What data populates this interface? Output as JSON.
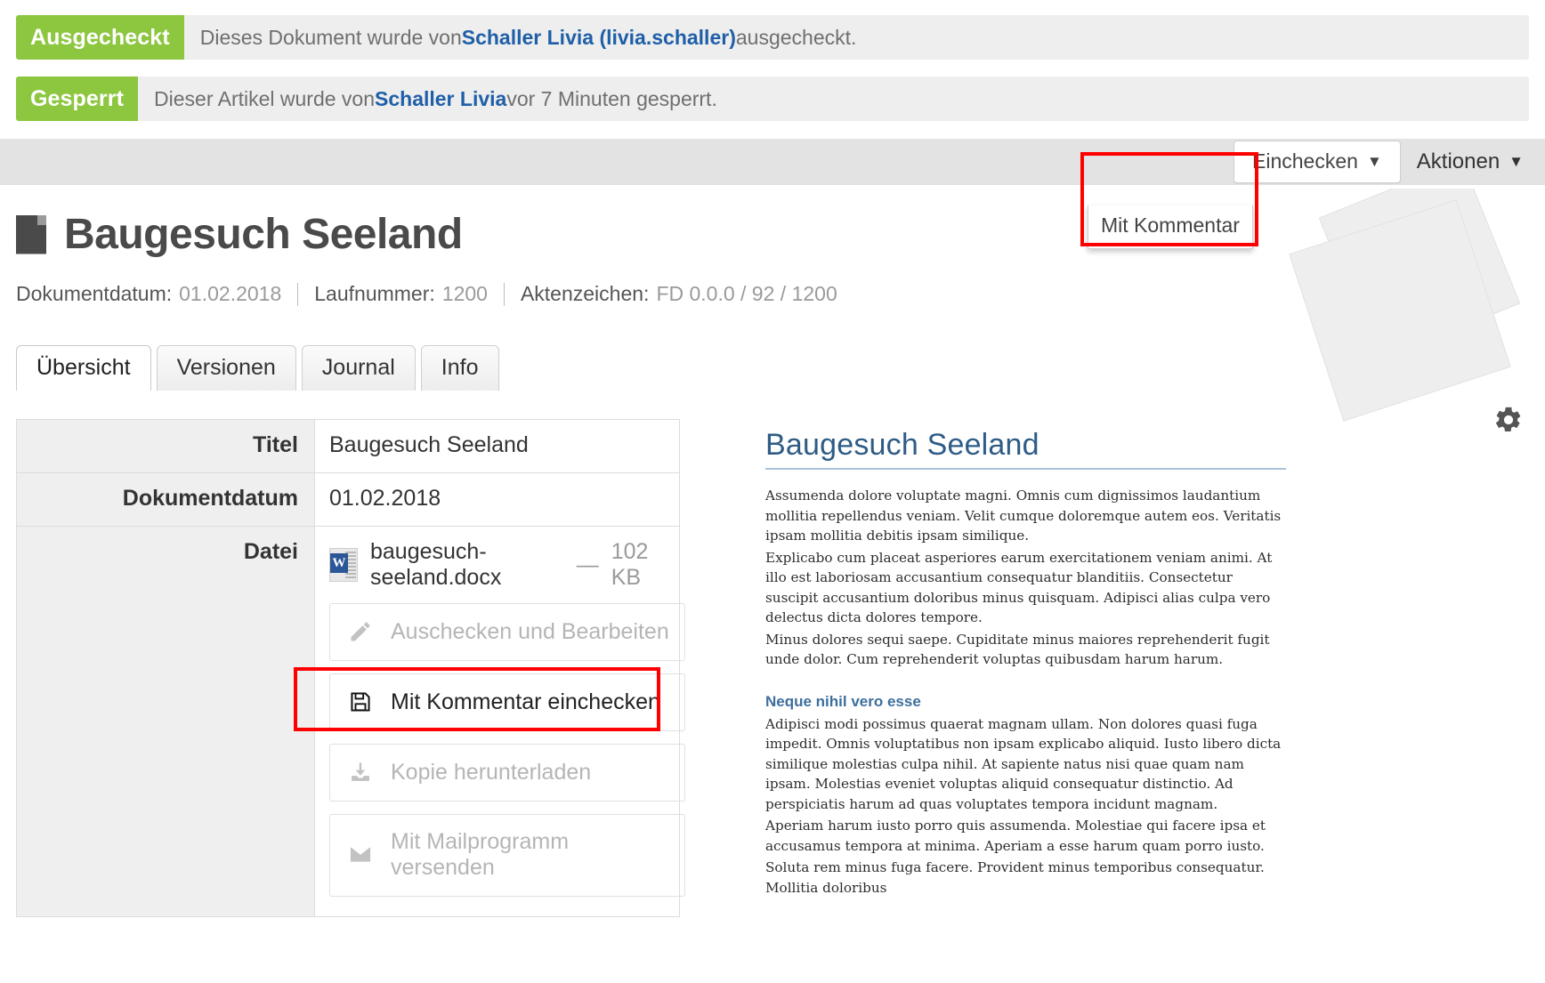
{
  "banners": [
    {
      "badge": "Ausgecheckt",
      "text_before": "Dieses Dokument wurde von ",
      "link": "Schaller Livia (livia.schaller)",
      "text_after": " ausgecheckt."
    },
    {
      "badge": "Gesperrt",
      "text_before": "Dieser Artikel wurde von ",
      "link": "Schaller Livia",
      "text_after": " vor 7 Minuten gesperrt."
    }
  ],
  "toolbar": {
    "einchecken_label": "Einchecken",
    "aktionen_label": "Aktionen",
    "caret": "▼",
    "dropdown_items": [
      "Mit Kommentar"
    ]
  },
  "header": {
    "title": "Baugesuch Seeland",
    "icon": "document-icon"
  },
  "meta": {
    "dokumentdatum_label": "Dokumentdatum:",
    "dokumentdatum_value": "01.02.2018",
    "laufnummer_label": "Laufnummer:",
    "laufnummer_value": "1200",
    "aktenzeichen_label": "Aktenzeichen:",
    "aktenzeichen_value": "FD 0.0.0 / 92 / 1200"
  },
  "tabs": [
    {
      "label": "Übersicht",
      "active": true
    },
    {
      "label": "Versionen",
      "active": false
    },
    {
      "label": "Journal",
      "active": false
    },
    {
      "label": "Info",
      "active": false
    }
  ],
  "info_table": {
    "rows": [
      {
        "key": "Titel",
        "value": "Baugesuch Seeland"
      },
      {
        "key": "Dokumentdatum",
        "value": "01.02.2018"
      },
      {
        "key": "Datei",
        "value": ""
      }
    ]
  },
  "file": {
    "name": "baugesuch-seeland.docx",
    "separator": "—",
    "size": "102 KB",
    "icon": "word-file-icon"
  },
  "actions": [
    {
      "label": "Auschecken und Bearbeiten",
      "icon": "pencil-icon",
      "enabled": false,
      "highlighted": false
    },
    {
      "label": "Mit Kommentar einchecken",
      "icon": "save-icon",
      "enabled": true,
      "highlighted": true
    },
    {
      "label": "Kopie herunterladen",
      "icon": "download-icon",
      "enabled": false,
      "highlighted": false
    },
    {
      "label": "Mit Mailprogramm versenden",
      "icon": "envelope-icon",
      "enabled": false,
      "highlighted": false
    }
  ],
  "preview": {
    "title": "Baugesuch Seeland",
    "paragraphs": [
      "Assumenda dolore voluptate magni. Omnis cum dignissimos laudantium mollitia repellendus veniam. Velit cumque doloremque autem eos. Veritatis ipsam mollitia debitis ipsam similique.",
      "Explicabo cum placeat asperiores earum exercitationem veniam animi. At illo est laboriosam accusantium consequatur blanditiis. Consectetur suscipit accusantium doloribus minus quisquam. Adipisci alias culpa vero delectus dicta dolores tempore.",
      "Minus dolores sequi saepe. Cupiditate minus maiores reprehenderit fugit unde dolor. Cum reprehenderit voluptas quibusdam harum harum."
    ],
    "subheading": "Neque nihil vero esse",
    "sub_paragraphs": [
      "Adipisci modi possimus quaerat magnam ullam. Non dolores quasi fuga impedit. Omnis voluptatibus non ipsam explicabo aliquid. Iusto libero dicta similique molestias culpa nihil. At sapiente natus nisi quae quam nam ipsam. Molestias eveniet voluptas aliquid consequatur distinctio. Ad perspiciatis harum ad quas voluptates tempora incidunt magnam.",
      "Aperiam harum iusto porro quis assumenda. Molestiae qui facere ipsa et accusamus tempora at minima. Aperiam a esse harum quam porro iusto.",
      "Soluta rem minus fuga facere. Provident minus temporibus consequatur. Mollitia doloribus"
    ]
  },
  "settings": {
    "icon": "gear-icon"
  },
  "colors": {
    "badge_green": "#8dc63f",
    "link_blue": "#1f5fa8",
    "highlight_red": "#ff0000",
    "preview_heading": "#2e5c86"
  }
}
